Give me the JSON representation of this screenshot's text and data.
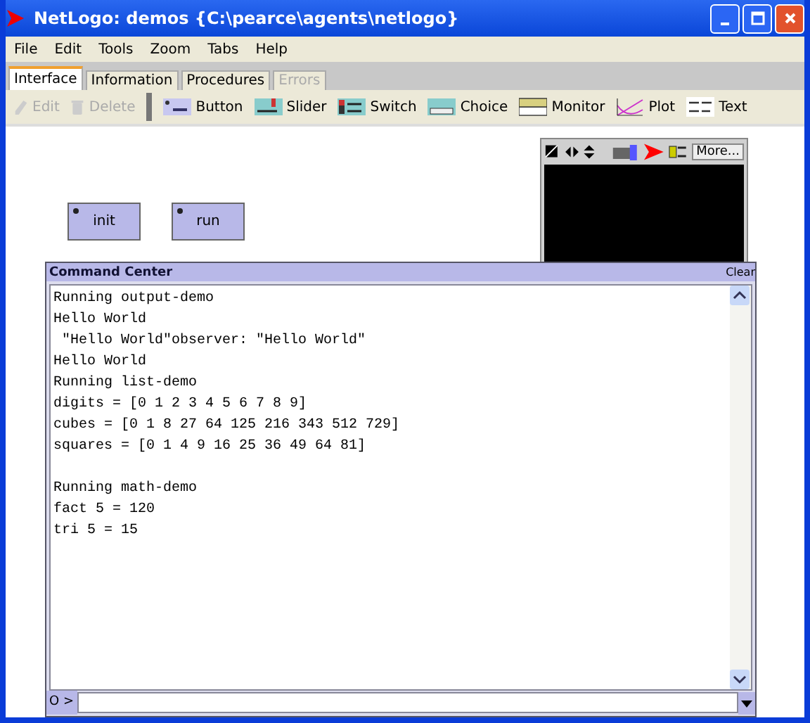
{
  "window": {
    "title": "NetLogo: demos {C:\\pearce\\agents\\netlogo}"
  },
  "menu": [
    "File",
    "Edit",
    "Tools",
    "Zoom",
    "Tabs",
    "Help"
  ],
  "tabs": [
    {
      "label": "Interface",
      "selected": true,
      "disabled": false
    },
    {
      "label": "Information",
      "selected": false,
      "disabled": false
    },
    {
      "label": "Procedures",
      "selected": false,
      "disabled": false
    },
    {
      "label": "Errors",
      "selected": false,
      "disabled": true
    }
  ],
  "toolbar": {
    "actions": [
      {
        "label": "Edit",
        "kind": "pencil",
        "disabled": true
      },
      {
        "label": "Delete",
        "kind": "trash",
        "disabled": true
      }
    ],
    "widgets": [
      {
        "label": "Button",
        "kind": "button"
      },
      {
        "label": "Slider",
        "kind": "slider"
      },
      {
        "label": "Switch",
        "kind": "switch"
      },
      {
        "label": "Choice",
        "kind": "choice"
      },
      {
        "label": "Monitor",
        "kind": "monitor"
      },
      {
        "label": "Plot",
        "kind": "plot"
      },
      {
        "label": "Text",
        "kind": "text"
      }
    ]
  },
  "buttons": [
    {
      "label": "init"
    },
    {
      "label": "run"
    }
  ],
  "view": {
    "more": "More..."
  },
  "command_center": {
    "title": "Command Center",
    "clear": "Clear",
    "prompt": "O >",
    "output": [
      [
        "Running output-demo",
        "Hello World",
        " \"Hello World\"observer: \"Hello World\"",
        "Hello World",
        "Running list-demo",
        "digits = [0 1 2 3 4 5 6 7 8 9]",
        "cubes = [0 1 8 27 64 125 216 343 512 729]",
        "squares = [0 1 4 9 16 25 36 49 64 81]"
      ],
      [
        "Running math-demo",
        "fact 5 = 120",
        "tri 5 = 15"
      ]
    ]
  }
}
